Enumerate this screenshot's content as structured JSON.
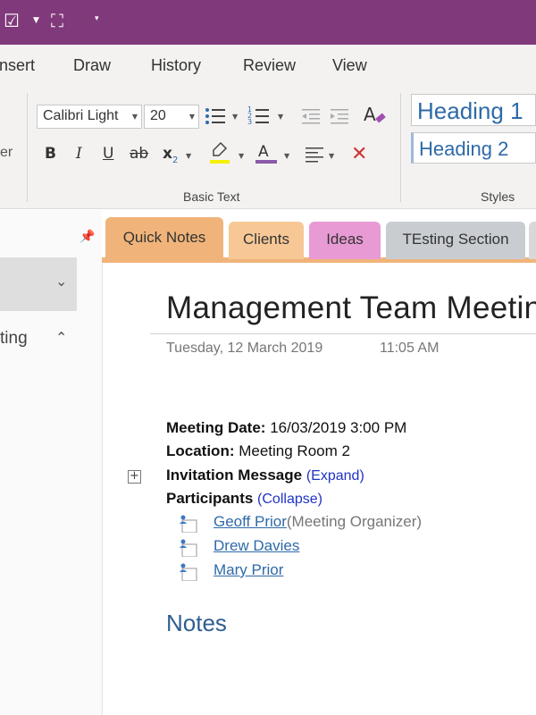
{
  "colors": {
    "title_bar": "#80397b",
    "tab_quick_notes": "#f0b47a",
    "tab_clients": "#f7c896",
    "tab_ideas": "#e89ad4",
    "tab_testing": "#c9cdd2",
    "link": "#2e6aa8",
    "collapse_expand": "#2033c6",
    "notes_heading": "#2e5e91"
  },
  "titlebar": {
    "icons": [
      "checklist-star-icon",
      "screen-clip-icon",
      "customize-toolbar-icon"
    ]
  },
  "menu": {
    "items": [
      "nsert",
      "Draw",
      "History",
      "Review",
      "View"
    ]
  },
  "ribbon": {
    "partial_label": "er",
    "font_name": "Calibri Light",
    "font_size": "20",
    "basic_text_label": "Basic Text",
    "styles_label": "Styles",
    "style_heading1": "Heading 1",
    "style_heading2": "Heading 2",
    "bold": "B",
    "italic": "I",
    "underline": "U",
    "strikethrough": "ab",
    "subscript": "x",
    "subscript_mark": "2"
  },
  "leftpanel": {
    "partial_item": "ting"
  },
  "tabs": [
    {
      "label": "Quick Notes"
    },
    {
      "label": "Clients"
    },
    {
      "label": "Ideas"
    },
    {
      "label": "TEsting Section"
    }
  ],
  "page": {
    "title": "Management Team Meeting",
    "date": "Tuesday, 12 March 2019",
    "time": "11:05 AM",
    "meeting_date_label": "Meeting Date:",
    "meeting_date_value": "16/03/2019 3:00 PM",
    "location_label": "Location:",
    "location_value": "Meeting Room 2",
    "invitation_label": "Invitation Message",
    "invitation_action": "(Expand)",
    "participants_label": "Participants",
    "participants_action": "(Collapse)",
    "participants": [
      {
        "name": "Geoff Prior",
        "role": " (Meeting Organizer)"
      },
      {
        "name": "Drew Davies",
        "role": ""
      },
      {
        "name": "Mary Prior",
        "role": ""
      }
    ],
    "notes_heading": "Notes"
  }
}
